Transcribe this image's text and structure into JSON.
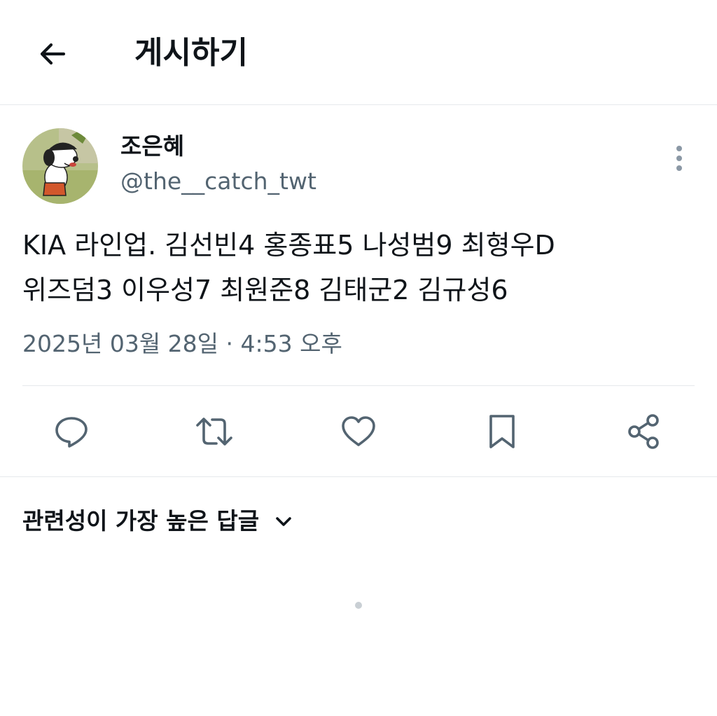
{
  "header": {
    "title": "게시하기",
    "back_icon": "arrow-left-icon"
  },
  "author": {
    "name": "조은혜",
    "handle": "@the__catch_twt",
    "avatar_icon": "snoopy-avatar"
  },
  "tweet": {
    "lines": [
      "KIA 라인업. 김선빈4 홍종표5 나성범9 최형우D",
      "위즈덤3 이우성7 최원준8 김태군2 김규성6"
    ],
    "date": "2025년 03월 28일",
    "separator": "·",
    "time": "4:53 오후"
  },
  "actions": [
    {
      "icon": "reply-icon"
    },
    {
      "icon": "retweet-icon"
    },
    {
      "icon": "like-icon"
    },
    {
      "icon": "bookmark-icon"
    },
    {
      "icon": "share-icon"
    }
  ],
  "replies": {
    "sort_label": "관련성이 가장 높은 답글"
  },
  "colors": {
    "text": "#0f1419",
    "secondary": "#536471",
    "divider": "#e6e9ec"
  }
}
